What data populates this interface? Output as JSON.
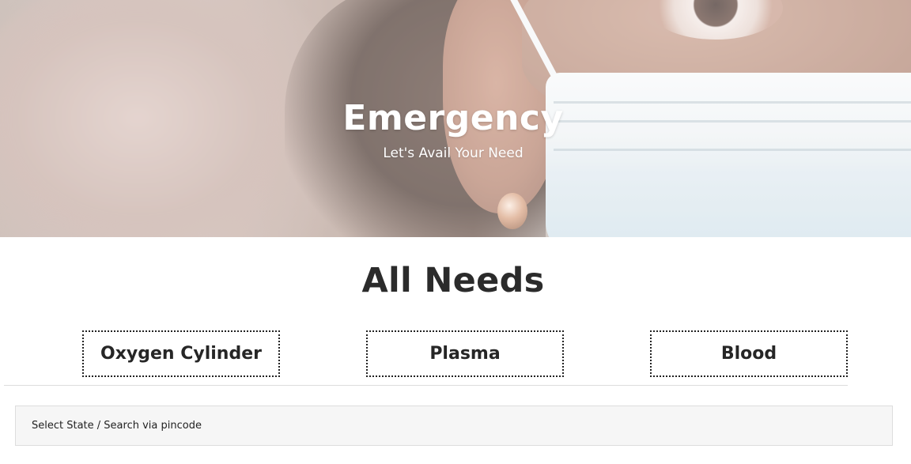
{
  "hero": {
    "title": "Emergency",
    "subtitle": "Let's Avail Your Need",
    "image": "woman-wearing-surgical-mask-photo"
  },
  "main": {
    "section_title": "All Needs",
    "needs": [
      {
        "label": "Oxygen Cylinder"
      },
      {
        "label": "Plasma"
      },
      {
        "label": "Blood"
      }
    ],
    "search": {
      "label": "Select State / Search via pincode"
    }
  },
  "colors": {
    "heading_text": "#2b2b2b",
    "hero_text": "#ffffff",
    "card_border": "#222222",
    "search_background": "#f6f6f6"
  }
}
